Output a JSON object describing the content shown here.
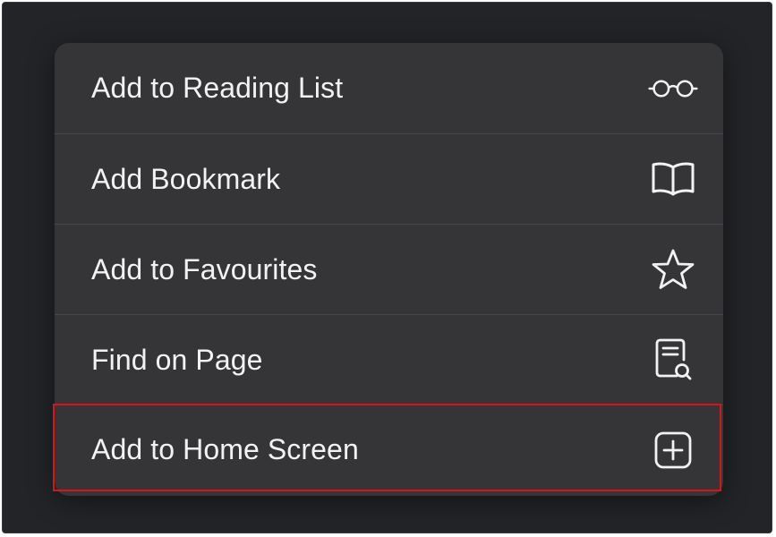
{
  "menu": {
    "items": [
      {
        "label": "Add to Reading List",
        "icon": "glasses-icon"
      },
      {
        "label": "Add Bookmark",
        "icon": "book-icon"
      },
      {
        "label": "Add to Favourites",
        "icon": "star-icon"
      },
      {
        "label": "Find on Page",
        "icon": "find-document-icon"
      },
      {
        "label": "Add to Home Screen",
        "icon": "add-square-icon"
      }
    ],
    "highlighted_item": "Add to Home Screen"
  },
  "colors": {
    "backdrop": "#232427",
    "menu_background": "#353538",
    "separator": "#47474b",
    "text": "#f2f2f4",
    "highlight_border": "#d8141b"
  }
}
